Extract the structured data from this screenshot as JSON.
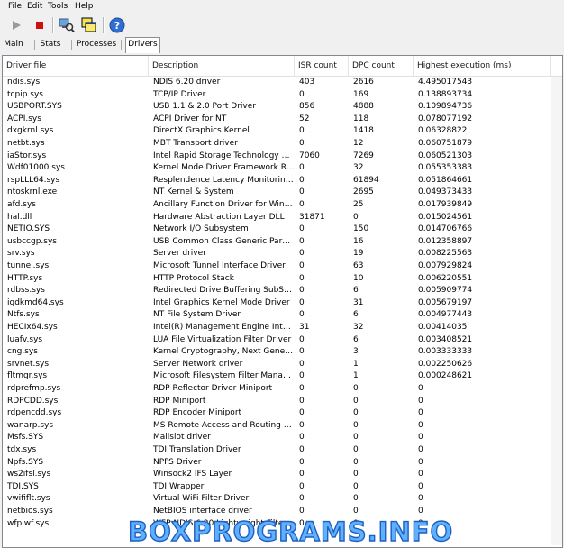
{
  "menu": {
    "items": [
      "File",
      "Edit",
      "Tools",
      "Help"
    ]
  },
  "tabs": {
    "items": [
      "Main",
      "Stats",
      "Processes",
      "Drivers"
    ],
    "active": 3
  },
  "columns": [
    "Driver file",
    "Description",
    "ISR count",
    "DPC count",
    "Highest execution (ms)"
  ],
  "rows": [
    [
      "ndis.sys",
      "NDIS 6.20 driver",
      "403",
      "2616",
      "4.495017543"
    ],
    [
      "tcpip.sys",
      "TCP/IP Driver",
      "0",
      "169",
      "0.138893734"
    ],
    [
      "USBPORT.SYS",
      "USB 1.1 & 2.0 Port Driver",
      "856",
      "4888",
      "0.109894736"
    ],
    [
      "ACPI.sys",
      "ACPI Driver for NT",
      "52",
      "118",
      "0.078077192"
    ],
    [
      "dxgkrnl.sys",
      "DirectX Graphics Kernel",
      "0",
      "1418",
      "0.06328822"
    ],
    [
      "netbt.sys",
      "MBT Transport driver",
      "0",
      "12",
      "0.060751879"
    ],
    [
      "iaStor.sys",
      "Intel Rapid Storage Technology driver",
      "7060",
      "7269",
      "0.060521303"
    ],
    [
      "Wdf01000.sys",
      "Kernel Mode Driver Framework Runtime",
      "0",
      "32",
      "0.055353383"
    ],
    [
      "rspLLL64.sys",
      "Resplendence Latency Monitoring and Auxiliary Kernel Library",
      "0",
      "61894",
      "0.051864661"
    ],
    [
      "ntoskrnl.exe",
      "NT Kernel & System",
      "0",
      "2695",
      "0.049373433"
    ],
    [
      "afd.sys",
      "Ancillary Function Driver for WinSock",
      "0",
      "25",
      "0.017939849"
    ],
    [
      "hal.dll",
      "Hardware Abstraction Layer DLL",
      "31871",
      "0",
      "0.015024561"
    ],
    [
      "NETIO.SYS",
      "Network I/O Subsystem",
      "0",
      "150",
      "0.014706766"
    ],
    [
      "usbccgp.sys",
      "USB Common Class Generic Parent Driver",
      "0",
      "16",
      "0.012358897"
    ],
    [
      "srv.sys",
      "Server driver",
      "0",
      "19",
      "0.008225563"
    ],
    [
      "tunnel.sys",
      "Microsoft Tunnel Interface Driver",
      "0",
      "63",
      "0.007929824"
    ],
    [
      "HTTP.sys",
      "HTTP Protocol Stack",
      "0",
      "10",
      "0.006220551"
    ],
    [
      "rdbss.sys",
      "Redirected Drive Buffering SubSystem Driver",
      "0",
      "6",
      "0.005909774"
    ],
    [
      "igdkmd64.sys",
      "Intel Graphics Kernel Mode Driver",
      "0",
      "31",
      "0.005679197"
    ],
    [
      "Ntfs.sys",
      "NT File System Driver",
      "0",
      "6",
      "0.004977443"
    ],
    [
      "HECIx64.sys",
      "Intel(R) Management Engine Interface",
      "31",
      "32",
      "0.00414035"
    ],
    [
      "luafv.sys",
      "LUA File Virtualization Filter Driver",
      "0",
      "6",
      "0.003408521"
    ],
    [
      "cng.sys",
      "Kernel Cryptography, Next Generation",
      "0",
      "3",
      "0.003333333"
    ],
    [
      "srvnet.sys",
      "Server Network driver",
      "0",
      "1",
      "0.002250626"
    ],
    [
      "fltmgr.sys",
      "Microsoft Filesystem Filter Manager",
      "0",
      "1",
      "0.000248621"
    ],
    [
      "rdprefmp.sys",
      "RDP Reflector Driver Miniport",
      "0",
      "0",
      "0"
    ],
    [
      "RDPCDD.sys",
      "RDP Miniport",
      "0",
      "0",
      "0"
    ],
    [
      "rdpencdd.sys",
      "RDP Encoder Miniport",
      "0",
      "0",
      "0"
    ],
    [
      "wanarp.sys",
      "MS Remote Access and Routing ARP Driver",
      "0",
      "0",
      "0"
    ],
    [
      "Msfs.SYS",
      "Mailslot driver",
      "0",
      "0",
      "0"
    ],
    [
      "tdx.sys",
      "TDI Translation Driver",
      "0",
      "0",
      "0"
    ],
    [
      "Npfs.SYS",
      "NPFS Driver",
      "0",
      "0",
      "0"
    ],
    [
      "ws2ifsl.sys",
      "Winsock2 IFS Layer",
      "0",
      "0",
      "0"
    ],
    [
      "TDI.SYS",
      "TDI Wrapper",
      "0",
      "0",
      "0"
    ],
    [
      "vwififlt.sys",
      "Virtual WiFi Filter Driver",
      "0",
      "0",
      "0"
    ],
    [
      "netbios.sys",
      "NetBIOS interface driver",
      "0",
      "0",
      "0"
    ],
    [
      "wfplwf.sys",
      "WFP NDIS 6.20 Lightweight Filter Driver",
      "0",
      "0",
      "0"
    ]
  ],
  "watermark": "BOXPROGRAMS.INFO",
  "colors": {
    "accent": "#2f6fd1",
    "watermark": "#5fb0ff"
  },
  "icons": [
    "play-icon",
    "stop-icon",
    "search-monitor-icon",
    "windows-icon",
    "help-icon"
  ]
}
